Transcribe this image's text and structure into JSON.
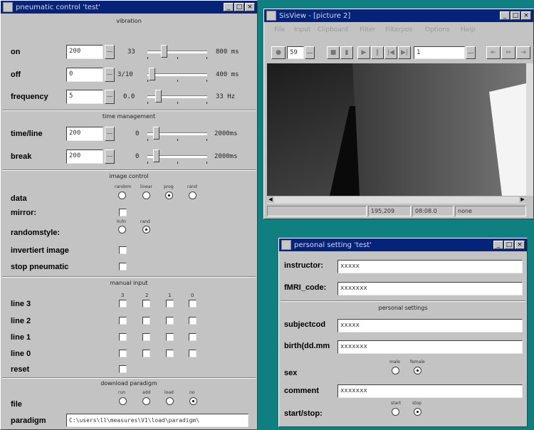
{
  "pneumatic": {
    "title": "pneumatic control 'test'",
    "sec_vibration": "vibration",
    "sec_time": "time management",
    "sec_image": "image control",
    "sec_manual": "manual input",
    "sec_paradigm": "download paradigm",
    "rows": {
      "on": {
        "label": "on",
        "value": "200",
        "min": "33",
        "max": "800 ms",
        "level": 0.25
      },
      "off": {
        "label": "off",
        "value": "0",
        "min": "3/10",
        "max": "400 ms",
        "level": 0.02
      },
      "freq": {
        "label": "frequency",
        "value": "5",
        "min": "0.0",
        "max": "33 Hz",
        "level": 0.15
      },
      "timeline": {
        "label": "time/line",
        "value": "200",
        "min": "0",
        "max": "2000ms",
        "level": 0.1
      },
      "break": {
        "label": "break",
        "value": "200",
        "min": "0",
        "max": "2000ms",
        "level": 0.1
      }
    },
    "data_label": "data",
    "data_opts": [
      "random",
      "linear",
      "prog",
      "rand"
    ],
    "mirror_label": "mirror:",
    "rand_label": "randomstyle:",
    "rand_opts": [
      "ln/ln",
      "rand"
    ],
    "invert_label": "invertiert image",
    "stop_label": "stop pneumatic",
    "manual_cols": [
      "3",
      "2",
      "1",
      "0"
    ],
    "lines": [
      "line 3",
      "line 2",
      "line 1",
      "line 0"
    ],
    "reset_label": "reset",
    "file_label": "file",
    "file_opts": [
      "run",
      "add",
      "load",
      "no"
    ],
    "paradigm_label": "paradigm",
    "paradigm_value": "C:\\users\\ll\\measures\\V1\\load\\paradigm\\"
  },
  "sisview": {
    "title": "SisView - [picture 2]",
    "menu": [
      "File",
      "Input",
      "Clipboard",
      "Filter",
      "Filterpos",
      "Options",
      "Help"
    ],
    "frame_value": "59",
    "page_value": "1",
    "status": [
      "195,209",
      "08:08.0",
      "none"
    ]
  },
  "personal": {
    "title": "personal setting 'test'",
    "instructor_label": "instructor:",
    "instructor_value": "xxxxx",
    "fmri_label": "fMRI_code:",
    "fmri_value": "xxxxxxx",
    "sec_personal": "personal settings",
    "subject_label": "subjectcod",
    "subject_value": "xxxxx",
    "birth_label": "birth(dd.mm",
    "birth_value": "xxxxxxx",
    "sex_label": "sex",
    "sex_opts": [
      "male",
      "female"
    ],
    "comment_label": "comment",
    "comment_value": "xxxxxxx",
    "start_label": "start/stop:",
    "start_opts": [
      "start",
      "stop"
    ]
  }
}
